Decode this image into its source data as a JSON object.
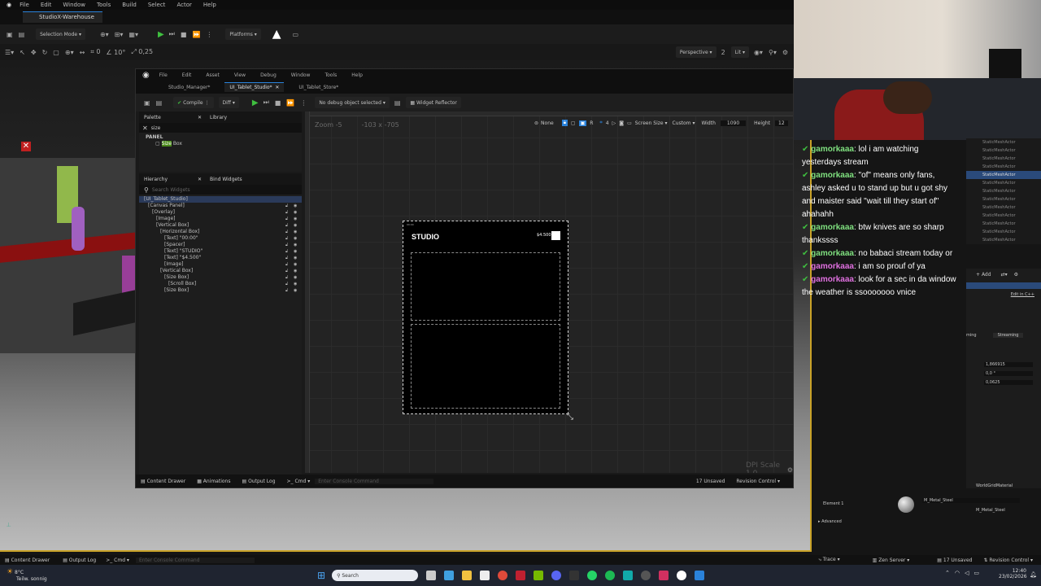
{
  "main_menu": [
    "File",
    "Edit",
    "Window",
    "Tools",
    "Build",
    "Select",
    "Actor",
    "Help"
  ],
  "main_tab": "StudioX-Warehouse",
  "main_toolbar": {
    "selection_mode": "Selection Mode",
    "platforms": "Platforms"
  },
  "viewport_toolbar": {
    "snap_rotation": "10°",
    "snap_scale": "0,25",
    "perspective": "Perspective",
    "lit": "Lit",
    "count": "2"
  },
  "wbp": {
    "menu": [
      "File",
      "Edit",
      "Asset",
      "View",
      "Debug",
      "Window",
      "Tools",
      "Help"
    ],
    "tabs": [
      "Studio_Manager*",
      "UI_Tablet_Studio*",
      "UI_Tablet_Store*"
    ],
    "compile": "Compile",
    "diff": "Diff",
    "debug_select": "No debug object selected",
    "widget_reflector": "Widget Reflector",
    "palette": {
      "tab1": "Palette",
      "tab2": "Library",
      "search": "size",
      "section": "PANEL",
      "item_highlight": "Size",
      "item_rest": " Box"
    },
    "hierarchy": {
      "tab1": "Hierarchy",
      "tab2": "Bind Widgets",
      "search_placeholder": "Search Widgets",
      "items": [
        {
          "label": "[UI_Tablet_Studio]",
          "depth": 0
        },
        {
          "label": "[Canvas Panel]",
          "depth": 1
        },
        {
          "label": "[Overlay]",
          "depth": 2
        },
        {
          "label": "[Image]",
          "depth": 3
        },
        {
          "label": "[Vertical Box]",
          "depth": 3
        },
        {
          "label": "[Horizontal Box]",
          "depth": 4
        },
        {
          "label": "[Text] \"00:00\"",
          "depth": 5
        },
        {
          "label": "[Spacer]",
          "depth": 5
        },
        {
          "label": "[Text] \"STUDIO\"",
          "depth": 5
        },
        {
          "label": "[Text] \"$4.500\"",
          "depth": 5
        },
        {
          "label": "[Image]",
          "depth": 5
        },
        {
          "label": "[Vertical Box]",
          "depth": 4
        },
        {
          "label": "[Size Box]",
          "depth": 5
        },
        {
          "label": "[Scroll Box]",
          "depth": 6
        },
        {
          "label": "[Size Box]",
          "depth": 5
        }
      ]
    },
    "designer": {
      "zoom": "Zoom -5",
      "coords": "-103 x -705",
      "none": "None",
      "screen_size": "Screen Size",
      "custom": "Custom",
      "width_label": "Width",
      "width_value": "1090",
      "height_label": "Height",
      "height_value": "12",
      "dpi_scale": "DPI Scale 1,0",
      "widget_title": "STUDIO",
      "widget_money": "$4.500",
      "widget_time": "00:00"
    },
    "bottom": {
      "content_drawer": "Content Drawer",
      "animations": "Animations",
      "output_log": "Output Log",
      "cmd": "Cmd",
      "console_placeholder": "Enter Console Command",
      "unsaved": "17 Unsaved",
      "revision": "Revision Control"
    }
  },
  "chat": [
    {
      "user": "gamorkaaa",
      "text": "lol i am watching yesterdays stream",
      "color": "#7fe07f",
      "badge": "#3fbf3f"
    },
    {
      "user": "gamorkaaa",
      "text": "\"of\" means only fans, ashley asked u to stand up but u got shy and maister said \"wait till they start of\" ahahahh",
      "color": "#7fe07f",
      "badge": "#3fbf3f"
    },
    {
      "user": "gamorkaaa",
      "text": "btw knives are so sharp thankssss",
      "color": "#7fe07f",
      "badge": "#3fbf3f"
    },
    {
      "user": "gamorkaaa",
      "text": "no babaci stream today or",
      "color": "#7fe07f",
      "badge": "#3fbf3f"
    },
    {
      "user": "gamorkaaa",
      "text": "i am so prouf of ya",
      "color": "#e070e0",
      "badge": "#3fbf3f"
    },
    {
      "user": "gamorkaaa",
      "text": "look for a sec in da window the weather is ssooooooo vnice",
      "color": "#e070e0",
      "badge": "#3fbf3f"
    }
  ],
  "outliner_items": [
    "StaticMeshActor",
    "StaticMeshActor",
    "StaticMeshActor",
    "StaticMeshActor",
    "StaticMeshActor",
    "StaticMeshActor",
    "StaticMeshActor",
    "StaticMeshActor",
    "StaticMeshActor",
    "StaticMeshActor",
    "StaticMeshActor",
    "StaticMeshActor",
    "StaticMeshActor"
  ],
  "details": {
    "add": "Add",
    "edit_cpp": "Edit in C++",
    "streaming": "Streaming",
    "v1": "1,866915",
    "v2": "0,0 °",
    "v3": "0,0625",
    "element": "Element 1",
    "material": "M_Metal_Steel",
    "world_material": "WorldGridMaterial",
    "advanced": "Advanced"
  },
  "bottom_bar": {
    "content_drawer": "Content Drawer",
    "output_log": "Output Log",
    "cmd": "Cmd",
    "console_placeholder": "Enter Console Command",
    "trace": "Trace",
    "zen": "Zen Server",
    "unsaved": "17 Unsaved",
    "revision": "Revision Control"
  },
  "taskbar": {
    "weather_temp": "8°C",
    "weather_desc": "Teilw. sonnig",
    "search": "Search",
    "time": "12:40",
    "date": "23/02/2026"
  }
}
